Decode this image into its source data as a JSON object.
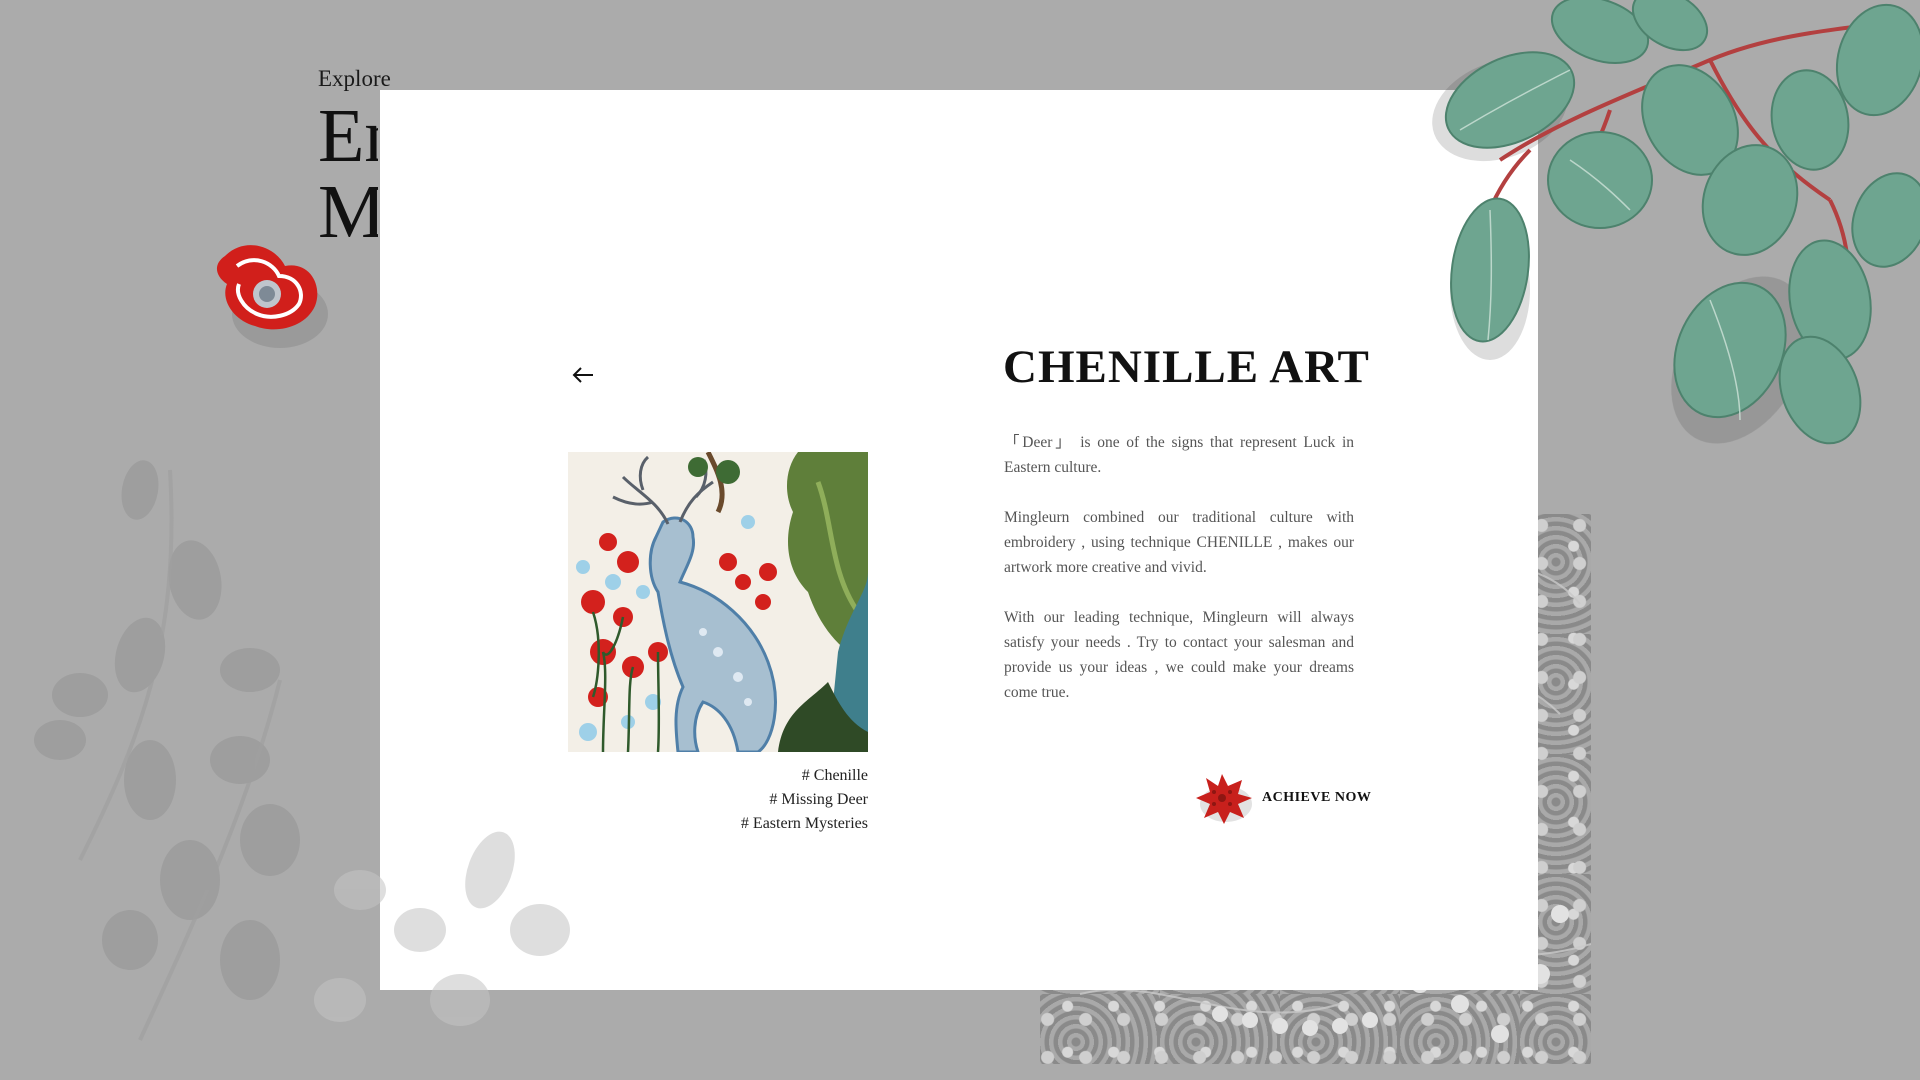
{
  "background": {
    "explore_label": "Explore",
    "headline_line1": "Em",
    "headline_line2": "M"
  },
  "modal": {
    "title": "CHENILLE ART",
    "paragraphs": [
      "「Deer」 is one of the  signs  that represent  Luck  in Eastern culture.",
      "Mingleurn  combined  our traditional  culture  with embroidery , using  technique CHENILLE , makes our artwork more creative and vivid.",
      "With our leading technique, Mingleurn will always satisfy  your needs .  Try  to  contact your salesman and  provide  us  your  ideas , we could make  your dreams come true."
    ],
    "tags": [
      "# Chenille",
      "# Missing Deer",
      "# Eastern Mysteries"
    ],
    "cta_label": "ACHIEVE NOW",
    "back_icon": "arrow-left-icon"
  },
  "colors": {
    "page_bg": "#ababab",
    "modal_bg": "#ffffff",
    "accent_red": "#c8201c",
    "leaf_green": "#6aa38c"
  }
}
